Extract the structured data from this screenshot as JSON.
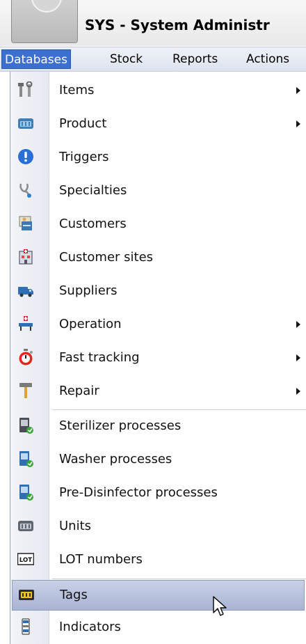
{
  "header": {
    "title": "SYS - System Administr"
  },
  "menubar": {
    "items": [
      {
        "label": "Databases"
      },
      {
        "label": "Stock"
      },
      {
        "label": "Reports"
      },
      {
        "label": "Actions"
      }
    ]
  },
  "dropdown": {
    "items": [
      {
        "label": "Items",
        "icon": "tools-icon"
      },
      {
        "label": "Product",
        "icon": "product-icon"
      },
      {
        "label": "Triggers",
        "icon": "info-icon"
      },
      {
        "label": "Specialties",
        "icon": "stethoscope-icon"
      },
      {
        "label": "Customers",
        "icon": "customers-icon"
      },
      {
        "label": "Customer sites",
        "icon": "hospital-icon"
      },
      {
        "label": "Suppliers",
        "icon": "truck-icon"
      },
      {
        "label": "Operation",
        "icon": "operation-bed-icon"
      },
      {
        "label": "Fast tracking",
        "icon": "stopwatch-icon"
      },
      {
        "label": "Repair",
        "icon": "hammer-icon"
      },
      {
        "label": "Sterilizer processes",
        "icon": "sterilizer-icon"
      },
      {
        "label": "Washer processes",
        "icon": "washer-icon"
      },
      {
        "label": "Pre-Disinfector processes",
        "icon": "pre-disinfector-icon"
      },
      {
        "label": "Units",
        "icon": "units-icon"
      },
      {
        "label": "LOT numbers",
        "icon": "lot-icon"
      },
      {
        "label": "Tags",
        "icon": "tag-icon"
      },
      {
        "label": "Indicators",
        "icon": "indicator-icon"
      }
    ]
  },
  "colors": {
    "menu_active": "#3d6fd0",
    "highlight": "#b7c0dc"
  }
}
